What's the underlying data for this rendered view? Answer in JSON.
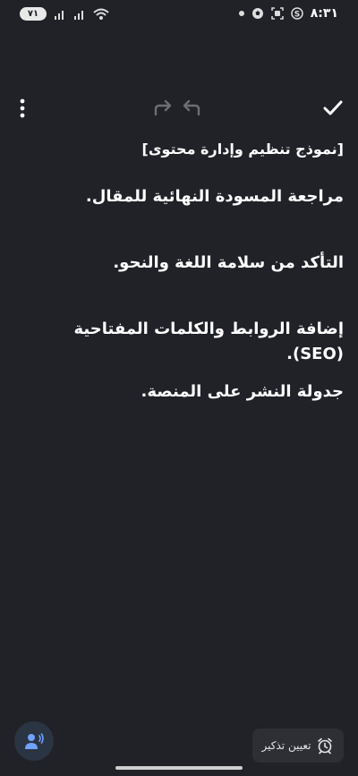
{
  "status_bar": {
    "battery_level": "٧١",
    "time": "٨:٣١",
    "left_icons": [
      "battery-icon",
      "signal-icon",
      "signal-icon",
      "wifi-icon"
    ],
    "right_icons": [
      "dot-icon",
      "soccer-icon",
      "screenshot-icon",
      "s-app-icon"
    ]
  },
  "toolbar": {
    "icons": [
      "more-vert-icon",
      "redo-icon",
      "undo-icon",
      "check-icon"
    ]
  },
  "note": {
    "title": "[نموذج تنظيم وإدارة محتوى]",
    "lines": [
      "مراجعة المسودة النهائية للمقال.",
      "التأكد من سلامة اللغة والنحو.",
      "إضافة الروابط والكلمات المفتاحية (SEO).",
      "جدولة النشر على المنصة."
    ]
  },
  "bottom": {
    "reminder_label": "تعيين تذكير",
    "icons": [
      "voice-icon",
      "alarm-icon"
    ]
  },
  "colors": {
    "background": "#202228",
    "text": "#ffffff",
    "voice_button_bg": "#2b3442",
    "voice_icon": "#6fa3ff",
    "reminder_bg": "#2d2f35"
  }
}
